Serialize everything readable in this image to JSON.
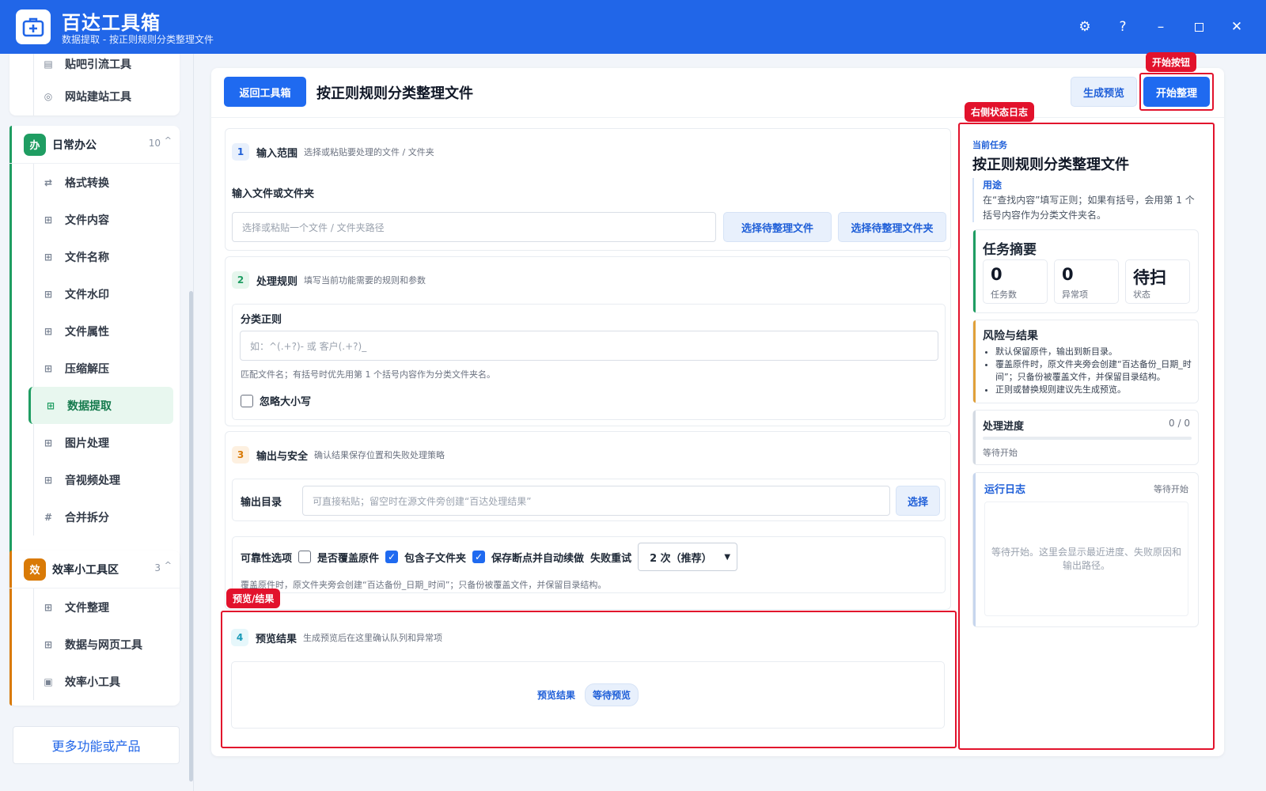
{
  "app": {
    "title": "百达工具箱",
    "subtitle": "数据提取 - 按正则规则分类整理文件"
  },
  "sidebar": {
    "group_top": {
      "items": [
        {
          "label": "贴吧引流工具",
          "icon": "doc-icon"
        },
        {
          "label": "网站建站工具",
          "icon": "globe-icon"
        }
      ]
    },
    "group_office": {
      "badge": "办",
      "title": "日常办公",
      "count": "10",
      "caret": "^",
      "color": "#1f9d62",
      "items": [
        {
          "label": "格式转换",
          "icon": "swap-icon"
        },
        {
          "label": "文件内容",
          "icon": "grid-icon"
        },
        {
          "label": "文件名称",
          "icon": "grid-icon"
        },
        {
          "label": "文件水印",
          "icon": "grid-icon"
        },
        {
          "label": "文件属性",
          "icon": "grid-icon"
        },
        {
          "label": "压缩解压",
          "icon": "grid-icon"
        },
        {
          "label": "数据提取",
          "icon": "grid-icon",
          "active": true
        },
        {
          "label": "图片处理",
          "icon": "grid-icon"
        },
        {
          "label": "音视频处理",
          "icon": "grid-icon"
        },
        {
          "label": "合并拆分",
          "icon": "hash-icon"
        }
      ]
    },
    "group_eff": {
      "badge": "效",
      "title": "效率小工具区",
      "count": "3",
      "caret": "^",
      "color": "#d97a06",
      "items": [
        {
          "label": "文件整理",
          "icon": "grid-icon"
        },
        {
          "label": "数据与网页工具",
          "icon": "grid-icon"
        },
        {
          "label": "效率小工具",
          "icon": "box-icon"
        }
      ]
    },
    "more_label": "更多功能或产品"
  },
  "header": {
    "back_label": "返回工具箱",
    "title": "按正则规则分类整理文件",
    "preview_label": "生成预览",
    "start_label": "开始整理",
    "start_tag": "开始按钮",
    "log_tag": "右侧状态日志",
    "preview_tag": "预览/结果"
  },
  "section1": {
    "num": "1",
    "title": "输入范围",
    "desc": "选择或粘贴要处理的文件 / 文件夹",
    "field_label": "输入文件或文件夹",
    "placeholder": "选择或粘贴一个文件 / 文件夹路径",
    "pick_file": "选择待整理文件",
    "pick_folder": "选择待整理文件夹"
  },
  "section2": {
    "num": "2",
    "title": "处理规则",
    "desc": "填写当前功能需要的规则和参数",
    "field_label": "分类正则",
    "placeholder": "如：^(.+?)- 或 客户(.+?)_",
    "hint": "匹配文件名；有括号时优先用第 1 个括号内容作为分类文件夹名。",
    "ignore_case": "忽略大小写"
  },
  "section3": {
    "num": "3",
    "title": "输出与安全",
    "desc": "确认结果保存位置和失败处理策略",
    "out_label": "输出目录",
    "out_placeholder": "可直接粘贴；留空时在源文件旁创建“百达处理结果”",
    "choose": "选择",
    "reliability_label": "可靠性选项",
    "opt_overwrite": "是否覆盖原件",
    "opt_subfolders": "包含子文件夹",
    "opt_resume": "保存断点并自动续做",
    "retry_label": "失败重试",
    "retry_value": "2 次（推荐）",
    "hint": "覆盖原件时，原文件夹旁会创建“百达备份_日期_时间”；只备份被覆盖文件，并保留目录结构。"
  },
  "section4": {
    "num": "4",
    "title": "预览结果",
    "desc": "生成预览后在这里确认队列和异常项",
    "result_label": "预览结果",
    "status": "等待预览"
  },
  "right": {
    "task_kicker": "当前任务",
    "task_title": "按正则规则分类整理文件",
    "usage_label": "用途",
    "usage_text": "在“查找内容”填写正则；如果有括号，会用第 1 个括号内容作为分类文件夹名。",
    "summary_title": "任务摘要",
    "stats": [
      {
        "value": "0",
        "label": "任务数"
      },
      {
        "value": "0",
        "label": "异常项"
      },
      {
        "value": "待扫",
        "label": "状态"
      }
    ],
    "risk_title": "风险与结果",
    "risks": [
      "默认保留原件，输出到新目录。",
      "覆盖原件时，原文件夹旁会创建“百达备份_日期_时间”；只备份被覆盖文件，并保留目录结构。",
      "正则或替换规则建议先生成预览。"
    ],
    "progress_title": "处理进度",
    "progress_count": "0 / 0",
    "progress_value": 0,
    "progress_status": "等待开始",
    "log_title": "运行日志",
    "log_status": "等待开始",
    "log_placeholder": "等待开始。这里会显示最近进度、失败原因和输出路径。"
  }
}
